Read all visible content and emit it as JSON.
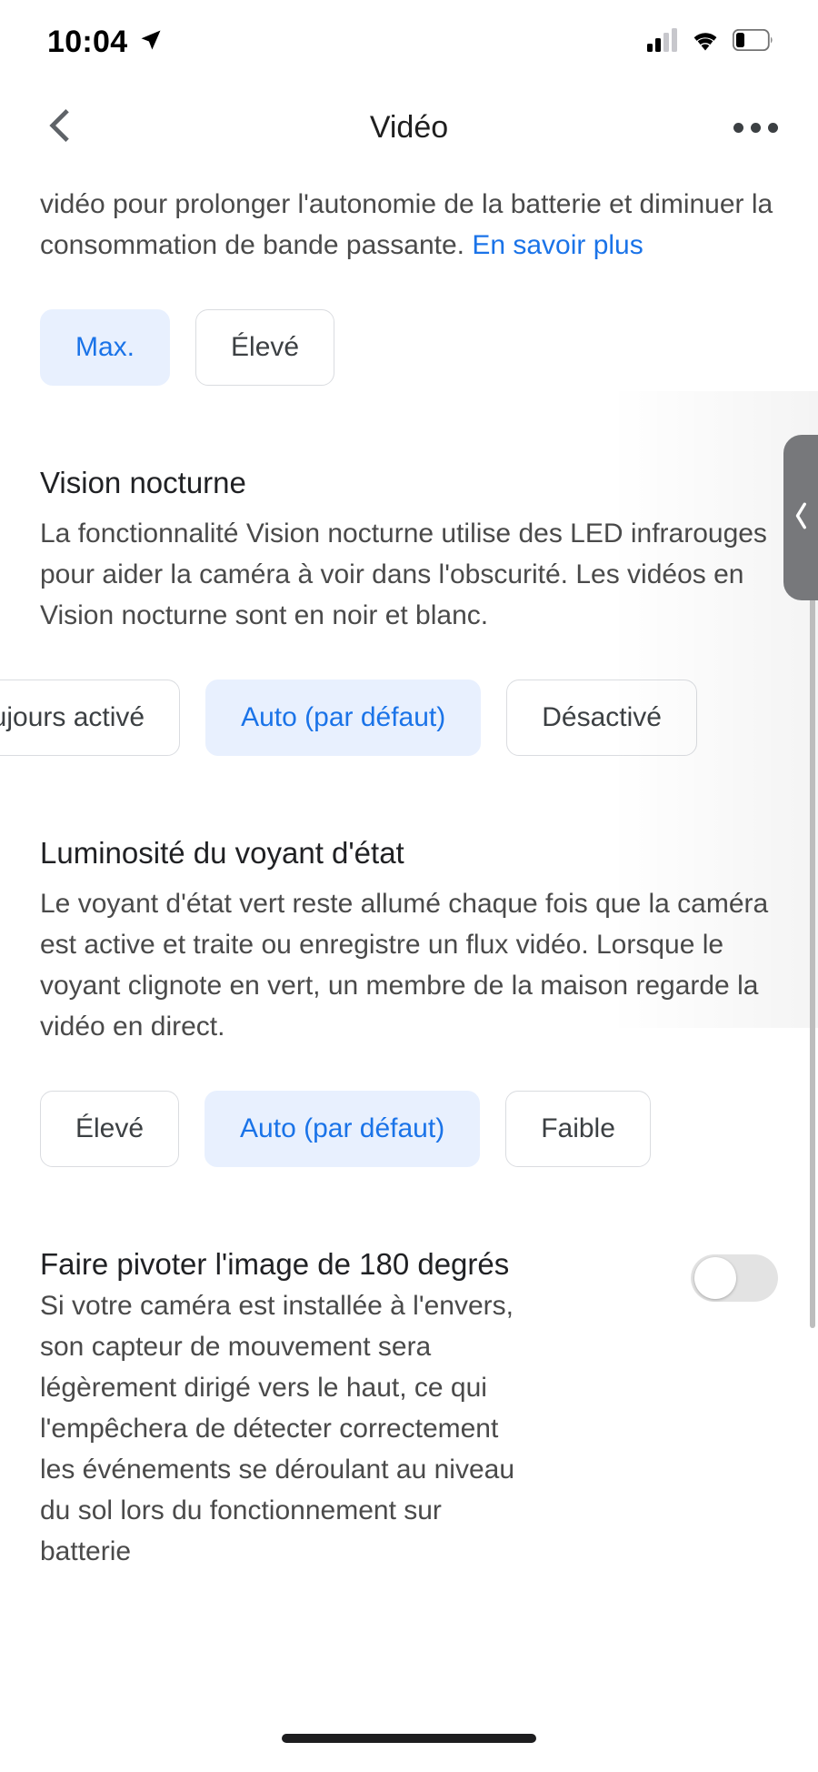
{
  "status_bar": {
    "time": "10:04",
    "location_icon": "location-arrow-icon",
    "cellular_icon": "cellular-signal-icon",
    "wifi_icon": "wifi-icon",
    "battery_icon": "battery-low-icon"
  },
  "nav": {
    "back_icon": "chevron-left-icon",
    "title": "Vidéo",
    "more_icon": "more-horizontal-icon"
  },
  "video_quality": {
    "description_part1": "vidéo pour prolonger l'autonomie de la batterie et diminuer la consommation de bande passante. ",
    "learn_more": "En savoir plus",
    "options": [
      {
        "label": "Max.",
        "selected": true
      },
      {
        "label": "Élevé",
        "selected": false
      }
    ]
  },
  "night_vision": {
    "title": "Vision nocturne",
    "description": "La fonctionnalité Vision nocturne utilise des LED infrarouges pour aider la caméra à voir dans l'obscurité. Les vidéos en Vision nocturne sont en noir et blanc.",
    "options": [
      {
        "label": "Toujours activé",
        "selected": false
      },
      {
        "label": "Auto (par défaut)",
        "selected": true
      },
      {
        "label": "Désactivé",
        "selected": false
      }
    ]
  },
  "status_light": {
    "title": "Luminosité du voyant d'état",
    "description": "Le voyant d'état vert reste allumé chaque fois que la caméra est active et traite ou enregistre un flux vidéo. Lorsque le voyant clignote en vert, un membre de la maison regarde la vidéo en direct.",
    "options": [
      {
        "label": "Élevé",
        "selected": false
      },
      {
        "label": "Auto (par défaut)",
        "selected": true
      },
      {
        "label": "Faible",
        "selected": false
      }
    ]
  },
  "rotate_image": {
    "title": "Faire pivoter l'image de 180 degrés",
    "description": "Si votre caméra est installée à l'envers, son capteur de mouvement sera légèrement dirigé vers le haut, ce qui l'empêchera de détecter correctement les événements se déroulant au niveau du sol lors du fonctionnement sur batterie",
    "toggle_state": "off"
  },
  "drawer": {
    "handle_icon": "chevron-left-icon"
  },
  "colors": {
    "accent_blue": "#1a73e8",
    "chip_selected_bg": "#e8f0fe",
    "chip_border": "#dadce0",
    "body_text": "#4a4a4a",
    "title_text": "#202124",
    "drawer_gray": "#77787b"
  }
}
